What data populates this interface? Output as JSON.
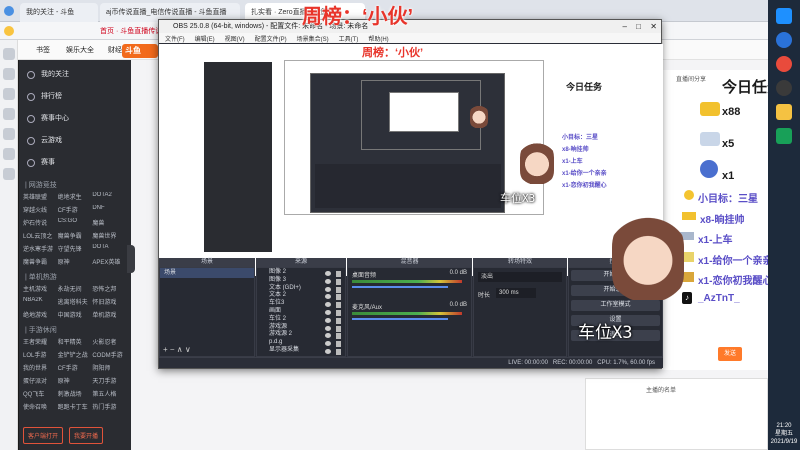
{
  "browser": {
    "tabs": [
      "我的关注 - 斗鱼",
      "aj币传说直播_电信传说直播 - 斗鱼直播",
      "扎实看 · Zero直播 - 斗鱼直播"
    ],
    "banner": "首页 · 斗鱼直播传说专区",
    "bookmarks_label": "书签",
    "bookmarks": [
      "娱乐大全",
      "财经",
      "游戏"
    ]
  },
  "site": {
    "logo": "斗鱼",
    "sidebar": {
      "main_items": [
        "我的关注",
        "排行榜",
        "赛事中心",
        "云游戏",
        "赛事"
      ],
      "sections": [
        {
          "title": "| 网游竞技",
          "items": [
            "英雄联盟",
            "绝地求生",
            "DOTA2",
            "穿越火线",
            "CF手游",
            "DNF",
            "炉石传说",
            "CS:GO",
            "魔兽",
            "LOL云顶之",
            "魔兽争霸",
            "魔兽世界",
            "逆水寒手游",
            "守望先锋",
            "DOTA",
            "魔兽争霸",
            "原神",
            "APEX英雄"
          ]
        },
        {
          "title": "| 单机热游",
          "items": [
            "主机游戏",
            "永劫无间",
            "恐怖之邦",
            "NBA2K",
            "逃离塔科夫",
            "怀旧游戏",
            "绝地游戏",
            "中国游戏",
            "单机游戏"
          ]
        },
        {
          "title": "| 手游休闲",
          "items": [
            "王者荣耀",
            "和平精英",
            "火影忍者",
            "LOL手游",
            "金铲铲之战",
            "CODM手游",
            "我的世界",
            "CF手游",
            "阴阳师",
            "蛋仔派对",
            "原神",
            "天刀手游",
            "QQ飞车",
            "刺激战场",
            "第五人格",
            "使命召唤",
            "跑跑卡丁车",
            "热门手游"
          ]
        }
      ],
      "bottom_buttons": [
        "客户端打开",
        "我要开播"
      ]
    },
    "right_panel": {
      "follow_label": "直播间分享",
      "send_button": "发送",
      "gift_label": "主播的名单"
    }
  },
  "obs": {
    "title": "OBS 25.0.8 (64-bit, windows) - 配置文件: 未命名 - 场景: 未命名",
    "menu": [
      "文件(F)",
      "编辑(E)",
      "视图(V)",
      "配置文件(P)",
      "场景集合(S)",
      "工具(T)",
      "帮助(H)"
    ],
    "panels": {
      "scenes": "场景",
      "sources": "来源",
      "mixer": "混音器",
      "transitions": "转场特效",
      "controls": "控件"
    },
    "scene_name": "场景",
    "sources": [
      "图像 2",
      "图像 3",
      "文本 (GDI+)",
      "文本 2",
      "车位3",
      "画面",
      "车位 2",
      "游戏源",
      "游戏源 2",
      "p.d.g",
      "显示器采集"
    ],
    "mixer": [
      {
        "name": "桌面音频",
        "level": "0.0 dB"
      },
      {
        "name": "麦克风/Aux",
        "level": "0.0 dB"
      }
    ],
    "transition": {
      "type": "淡出",
      "duration_label": "时长",
      "duration": "300 ms"
    },
    "controls": [
      "开始直播",
      "开始录制",
      "工作室模式",
      "设置",
      "退出"
    ],
    "status": {
      "live": "LIVE: 00:00:00",
      "rec": "REC: 00:00:00",
      "cpu": "CPU: 1.7%, 60.00 fps"
    }
  },
  "overlay": {
    "title": "周榜：‘小伙’",
    "task_title": "今日任务",
    "tasks": [
      {
        "icon": "gold-bar-icon",
        "count": "x88"
      },
      {
        "icon": "plane-icon",
        "count": "x5"
      },
      {
        "icon": "rocket-icon",
        "count": "x1"
      }
    ],
    "goals": [
      "小目标：三星",
      "x8-晌挂帅",
      "x1-上车",
      "x1-给你一个亲亲",
      "x1-恋你初我醒心"
    ],
    "tiktok": "_AzTnT_",
    "seat_label": "车位X3"
  },
  "taskbar": {
    "time": "21:20",
    "weekday": "星期五",
    "date": "2021/9/19"
  }
}
